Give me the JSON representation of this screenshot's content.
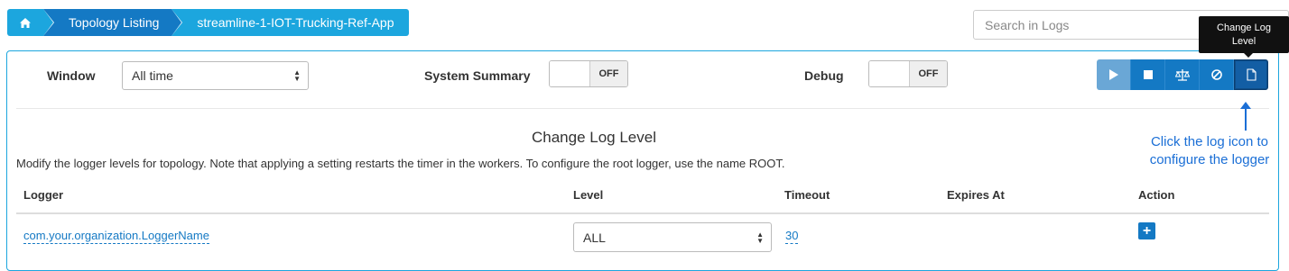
{
  "breadcrumb": {
    "home_icon": "home-icon",
    "items": [
      "Topology Listing",
      "streamline-1-IOT-Trucking-Ref-App"
    ]
  },
  "search": {
    "placeholder": "Search in Logs"
  },
  "tooltip": {
    "text": "Change Log Level"
  },
  "controls": {
    "window_label": "Window",
    "window_value": "All time",
    "summary_label": "System Summary",
    "summary_state": "OFF",
    "debug_label": "Debug",
    "debug_state": "OFF",
    "buttons": [
      "play-icon",
      "stop-icon",
      "balance-icon",
      "ban-icon",
      "file-icon"
    ]
  },
  "log_level": {
    "title": "Change Log Level",
    "description": "Modify the logger levels for topology. Note that applying a setting restarts the timer in the workers. To configure the root logger, use the name ROOT.",
    "headers": {
      "logger": "Logger",
      "level": "Level",
      "timeout": "Timeout",
      "expires": "Expires At",
      "action": "Action"
    },
    "row": {
      "logger": "com.your.organization.LoggerName",
      "level": "ALL",
      "timeout": "30",
      "action_icon": "plus-icon"
    }
  },
  "annotation": {
    "text": "Click the log icon to configure the logger"
  },
  "colors": {
    "primary": "#1479c4",
    "light": "#1ca6de",
    "annotation": "#1b6fd6"
  }
}
